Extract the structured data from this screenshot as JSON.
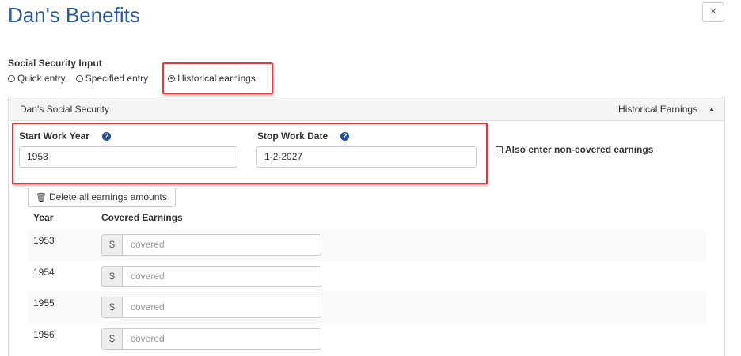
{
  "modal": {
    "title": "Dan's Benefits",
    "close_label": "×"
  },
  "ss_input": {
    "label": "Social Security Input",
    "options": [
      {
        "label": "Quick entry",
        "selected": false
      },
      {
        "label": "Specified entry",
        "selected": false
      },
      {
        "label": "Historical earnings",
        "selected": true
      }
    ]
  },
  "panel": {
    "title": "Dan's Social Security",
    "mode": "Historical Earnings",
    "caret": "▲",
    "start_work_year": {
      "label": "Start Work Year",
      "value": "1953"
    },
    "stop_work_date": {
      "label": "Stop Work Date",
      "value": "1-2-2027"
    },
    "non_covered": {
      "label": "Also enter non-covered earnings",
      "checked": false
    },
    "delete_button": "Delete all earnings amounts",
    "columns": [
      "Year",
      "Covered Earnings"
    ],
    "rows": [
      {
        "year": "1953",
        "currency": "$",
        "placeholder": "covered"
      },
      {
        "year": "1954",
        "currency": "$",
        "placeholder": "covered"
      },
      {
        "year": "1955",
        "currency": "$",
        "placeholder": "covered"
      },
      {
        "year": "1956",
        "currency": "$",
        "placeholder": "covered"
      }
    ]
  },
  "colors": {
    "title": "#2a5a9e",
    "highlight": "#e0393e",
    "help_icon": "#1f4f9a"
  },
  "icons": {
    "help": "question-circle-icon",
    "trash": "trash-icon",
    "caret": "caret-up-icon"
  }
}
